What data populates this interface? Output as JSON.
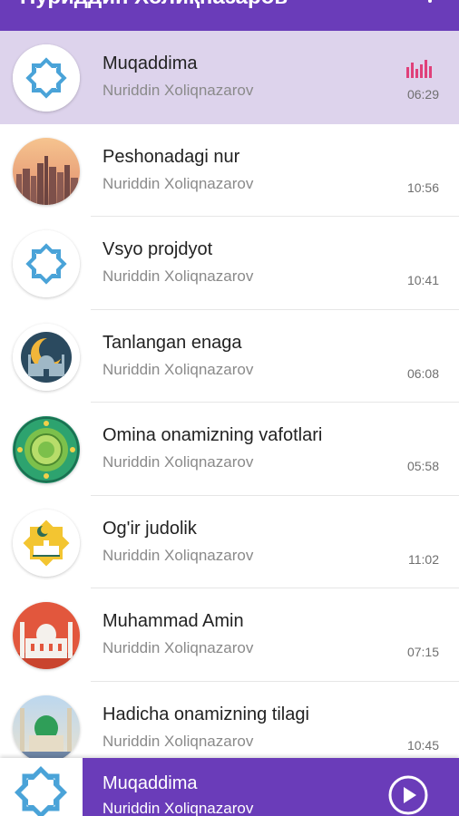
{
  "app": {
    "title": "Нуриддин Холиқназаров"
  },
  "tracks": [
    {
      "title": "Muqaddima",
      "artist": "Nuriddin Xoliqnazarov",
      "duration": "06:29",
      "art": "star-icon",
      "playing": true
    },
    {
      "title": "Peshonadagi nur",
      "artist": "Nuriddin Xoliqnazarov",
      "duration": "10:56",
      "art": "city-sunset-icon"
    },
    {
      "title": "Vsyo projdyot",
      "artist": "Nuriddin Xoliqnazarov",
      "duration": "10:41",
      "art": "star-icon"
    },
    {
      "title": "Tanlangan enaga",
      "artist": "Nuriddin Xoliqnazarov",
      "duration": "06:08",
      "art": "mosque-moon-icon"
    },
    {
      "title": "Omina onamizning vafotlari",
      "artist": "Nuriddin Xoliqnazarov",
      "duration": "05:58",
      "art": "ornament-icon"
    },
    {
      "title": "Og'ir judolik",
      "artist": "Nuriddin Xoliqnazarov",
      "duration": "11:02",
      "art": "crescent-star-icon"
    },
    {
      "title": "Muhammad Amin",
      "artist": "Nuriddin Xoliqnazarov",
      "duration": "07:15",
      "art": "mosque-red-icon"
    },
    {
      "title": "Hadicha onamizning tilagi",
      "artist": "Nuriddin Xoliqnazarov",
      "duration": "10:45",
      "art": "mosque-green-icon"
    }
  ],
  "player": {
    "title": "Muqaddima",
    "artist": "Nuriddin Xoliqnazarov",
    "state": "paused"
  },
  "colors": {
    "primary": "#6a3cb9",
    "active_row": "#ddd3ec",
    "equalizer": "#e0407a",
    "star_blue": "#4aa3d8"
  }
}
